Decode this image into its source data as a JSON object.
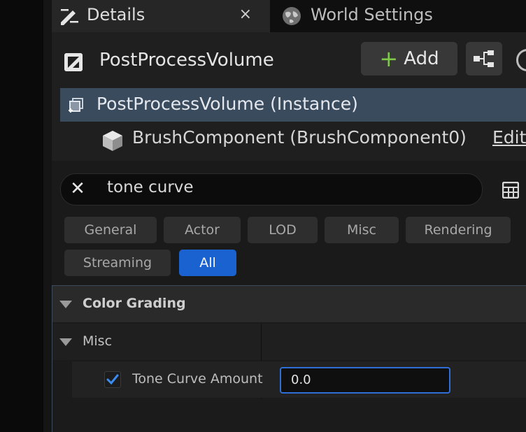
{
  "tabs": [
    {
      "label": "Details",
      "close": "×"
    },
    {
      "label": "World Settings"
    }
  ],
  "actor": {
    "name": "PostProcessVolume",
    "add_button": {
      "icon": "+",
      "label": "Add"
    }
  },
  "components": {
    "instance_label": "PostProcessVolume (Instance)",
    "brush_label": "BrushComponent (BrushComponent0)",
    "edit_link": "Edit"
  },
  "search": {
    "clear_icon": "✕",
    "value": "tone curve"
  },
  "filters": [
    {
      "label": "General"
    },
    {
      "label": "Actor"
    },
    {
      "label": "LOD"
    },
    {
      "label": "Misc"
    },
    {
      "label": "Rendering"
    },
    {
      "label": "Streaming"
    },
    {
      "label": "All",
      "active": true
    }
  ],
  "properties": {
    "category": "Color Grading",
    "subcategory": "Misc",
    "row": {
      "label": "Tone Curve Amount",
      "checked": true,
      "value": "0.0"
    }
  },
  "colors": {
    "accent_blue": "#1b62d1",
    "selection_row": "#3a4b5e",
    "add_green": "#7ec94a"
  }
}
